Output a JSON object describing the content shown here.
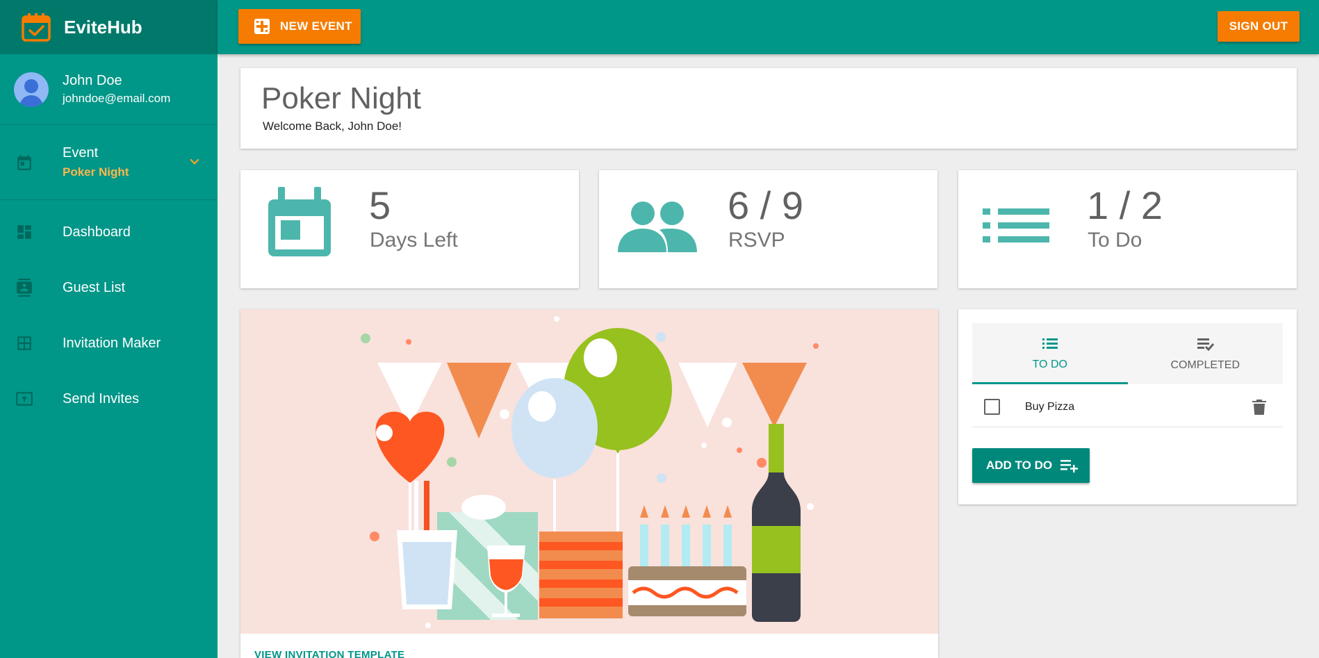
{
  "app": {
    "name": "EviteHub",
    "accent": "#009688",
    "accent_dark": "#00796b",
    "orange": "#f57c00"
  },
  "user": {
    "name": "John Doe",
    "email": "johndoe@email.com"
  },
  "sidebar": {
    "event_label": "Event",
    "event_value": "Poker Night",
    "items": [
      {
        "label": "Dashboard",
        "icon": "dashboard-icon"
      },
      {
        "label": "Guest List",
        "icon": "contact-card-icon"
      },
      {
        "label": "Invitation Maker",
        "icon": "grid-icon"
      },
      {
        "label": "Send Invites",
        "icon": "upload-icon"
      }
    ]
  },
  "topbar": {
    "new_event_label": "NEW EVENT",
    "sign_out_label": "SIGN OUT"
  },
  "header": {
    "title": "Poker Night",
    "welcome": "Welcome Back, John Doe!"
  },
  "stats": [
    {
      "value": "5",
      "label": "Days Left",
      "icon": "calendar-icon"
    },
    {
      "value": "6 / 9",
      "label": "RSVP",
      "icon": "people-icon"
    },
    {
      "value": "1 / 2",
      "label": "To Do",
      "icon": "list-icon"
    }
  ],
  "invitation": {
    "link_label": "VIEW INVITATION TEMPLATE",
    "image": "party-illustration"
  },
  "todo": {
    "tabs": [
      {
        "label": "TO DO",
        "icon": "list-icon",
        "active": true
      },
      {
        "label": "COMPLETED",
        "icon": "playlist-check-icon",
        "active": false
      }
    ],
    "items": [
      {
        "text": "Buy Pizza",
        "checked": false
      }
    ],
    "add_label": "ADD TO DO"
  }
}
